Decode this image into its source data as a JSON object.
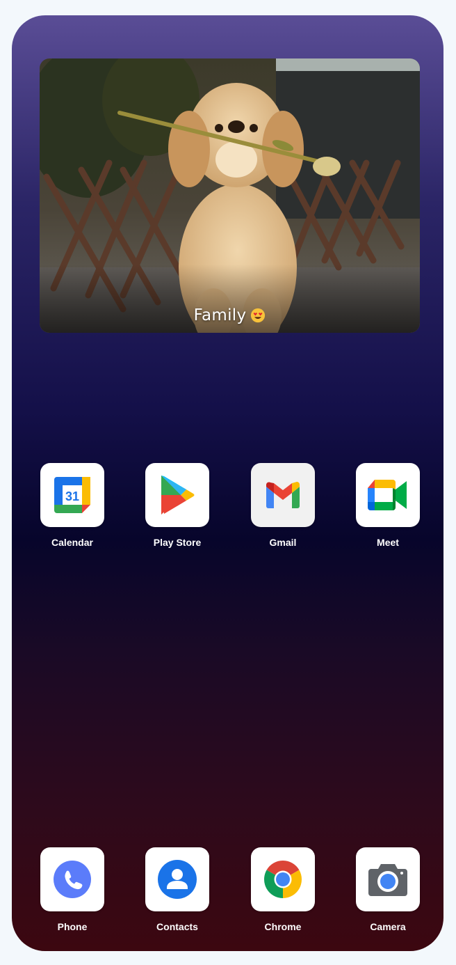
{
  "widget": {
    "caption": "Family",
    "caption_emoji": "heart-eyes-emoji",
    "photo": "golden-retriever-with-tulip"
  },
  "apps_row": [
    {
      "label": "Calendar",
      "icon": "calendar-icon",
      "day": "31"
    },
    {
      "label": "Play Store",
      "icon": "play-store-icon"
    },
    {
      "label": "Gmail",
      "icon": "gmail-icon"
    },
    {
      "label": "Meet",
      "icon": "meet-icon"
    }
  ],
  "dock": [
    {
      "label": "Phone",
      "icon": "phone-icon"
    },
    {
      "label": "Contacts",
      "icon": "contacts-icon"
    },
    {
      "label": "Chrome",
      "icon": "chrome-icon"
    },
    {
      "label": "Camera",
      "icon": "camera-icon"
    }
  ],
  "colors": {
    "gradient_top": "#5a4d96",
    "gradient_mid": "#07052b",
    "gradient_bottom": "#3c0710"
  }
}
